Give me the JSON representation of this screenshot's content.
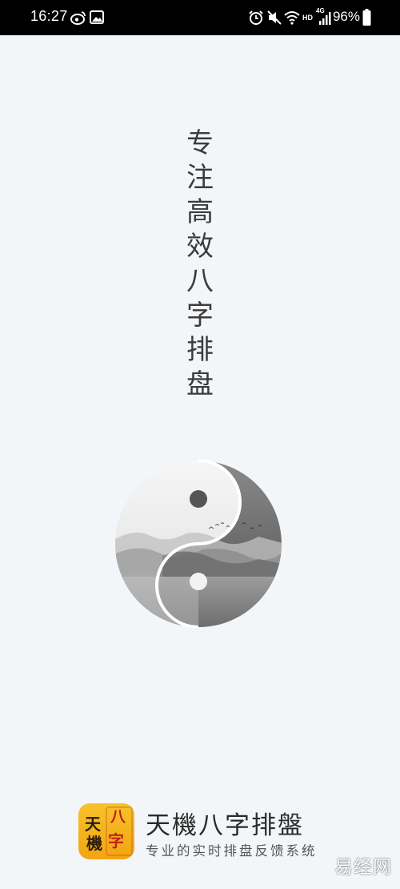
{
  "status_bar": {
    "time": "16:27",
    "battery_percent": "96%",
    "network_label": "4G",
    "hd_label": "HD",
    "left_icons": [
      "weibo-icon",
      "image-icon"
    ],
    "right_icons": [
      "alarm-icon",
      "mute-icon",
      "wifi-icon",
      "signal-icon",
      "battery-icon"
    ]
  },
  "slogan": {
    "characters": [
      "专",
      "注",
      "高",
      "效",
      "八",
      "字",
      "排",
      "盘"
    ]
  },
  "emblem": {
    "icon": "yin-yang-landscape-icon"
  },
  "footer": {
    "logo_characters": {
      "tian": "天",
      "ji": "機",
      "ba": "八",
      "zi": "字"
    },
    "app_name": "天機八字排盤",
    "tagline": "专业的实时排盘反馈系统"
  },
  "watermark": "易经网",
  "colors": {
    "background": "#f3f6f9",
    "status_bar": "#000000",
    "logo_gold": "#f1a512",
    "logo_red": "#c0201c"
  }
}
